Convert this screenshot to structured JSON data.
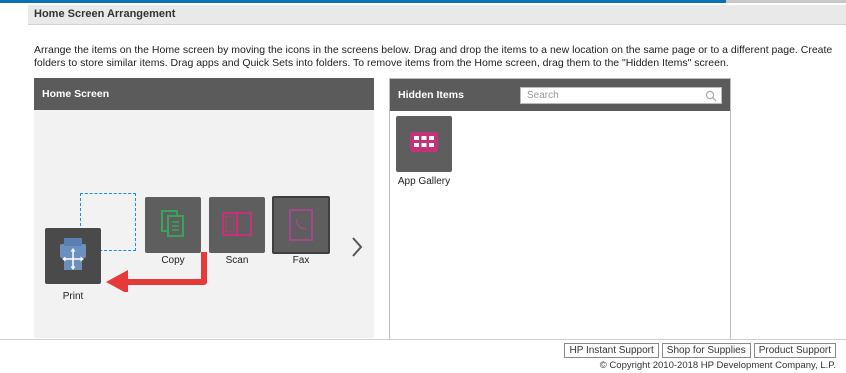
{
  "section": {
    "title": "Home Screen Arrangement"
  },
  "instructions": "Arrange the items on the Home screen by moving the icons in the screens below. Drag and drop the items to a new location on the same page or to a different page. Create folders to store similar items. Drag apps and Quick Sets into folders. To remove items from the Home screen, drag them to the \"Hidden Items\" screen.",
  "home_screen": {
    "title": "Home Screen",
    "items": [
      {
        "label": "Print",
        "icon": "print-icon",
        "color": "#4a4a4a"
      },
      {
        "label": "Copy",
        "icon": "copy-icon",
        "color": "#5e5e5e"
      },
      {
        "label": "Scan",
        "icon": "scan-icon",
        "color": "#5e5e5e"
      },
      {
        "label": "Fax",
        "icon": "fax-icon",
        "color": "#5e5e5e"
      }
    ]
  },
  "hidden_items": {
    "title": "Hidden Items",
    "search_placeholder": "Search",
    "items": [
      {
        "label": "App Gallery",
        "icon": "app-gallery-icon",
        "color": "#5e5e5e"
      }
    ]
  },
  "footer": {
    "links": [
      "HP Instant Support",
      "Shop for Supplies",
      "Product Support"
    ],
    "copyright": "© Copyright 2010-2018 HP Development Company, L.P."
  },
  "colors": {
    "accent": "#0b6fb5",
    "drag_arrow": "#e63a3a",
    "drop_outline": "#1a8fd9",
    "copy_green": "#3aa35b",
    "scan_magenta": "#c2337a",
    "fax_purple": "#a04a8c"
  }
}
